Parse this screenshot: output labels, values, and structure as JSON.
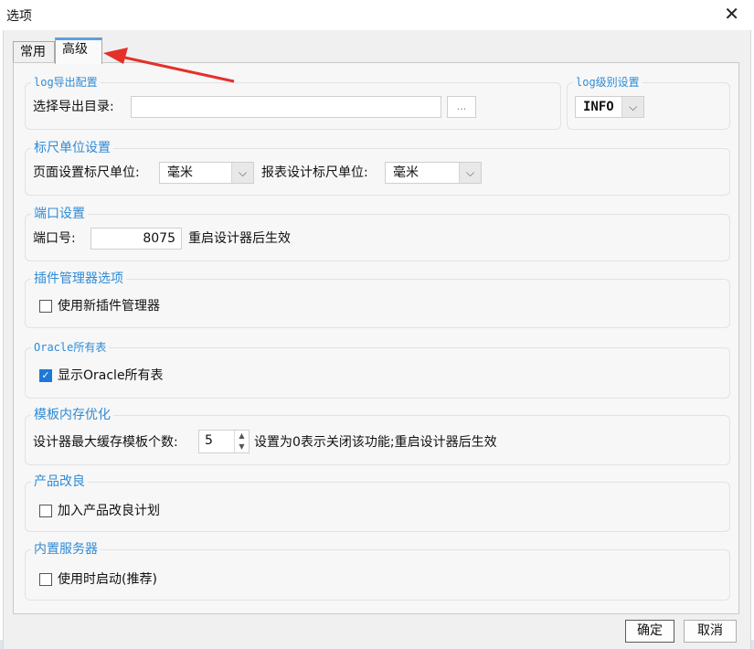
{
  "window": {
    "title": "选项",
    "close_glyph": "✕"
  },
  "tabs": [
    {
      "label": "常用",
      "active": false
    },
    {
      "label": "高级",
      "active": true
    }
  ],
  "log_export": {
    "title": "log导出配置",
    "dir_label": "选择导出目录:",
    "dir_value": "",
    "browse_label": "..."
  },
  "log_level": {
    "title": "log级别设置",
    "value": "INFO"
  },
  "ruler": {
    "title": "标尺单位设置",
    "page_label": "页面设置标尺单位:",
    "page_value": "毫米",
    "report_label": "报表设计标尺单位:",
    "report_value": "毫米"
  },
  "port": {
    "title": "端口设置",
    "label": "端口号:",
    "value": "8075",
    "note": "重启设计器后生效"
  },
  "plugin": {
    "title": "插件管理器选项",
    "checkbox_label": "使用新插件管理器",
    "checked": false
  },
  "oracle": {
    "title": "Oracle所有表",
    "checkbox_label": "显示Oracle所有表",
    "checked": true
  },
  "template_cache": {
    "title": "模板内存优化",
    "label": "设计器最大缓存模板个数:",
    "value": "5",
    "note": "设置为0表示关闭该功能;重启设计器后生效"
  },
  "improvement": {
    "title": "产品改良",
    "checkbox_label": "加入产品改良计划",
    "checked": false
  },
  "server": {
    "title": "内置服务器",
    "checkbox_label": "使用时启动(推荐)",
    "checked": false
  },
  "footer": {
    "ok_label": "确定",
    "cancel_label": "取消"
  },
  "colors": {
    "group_title": "#2f8bd6",
    "tab_accent": "#5aa0e0",
    "annotation_arrow": "#e5302a",
    "checkbox_checked": "#1e78d7"
  },
  "icons": {
    "close": "close-icon",
    "dropdown": "chevron-down-icon",
    "spinner": "spinner-arrows-icon",
    "check": "checkmark-icon",
    "annotation": "red-arrow-annotation"
  }
}
